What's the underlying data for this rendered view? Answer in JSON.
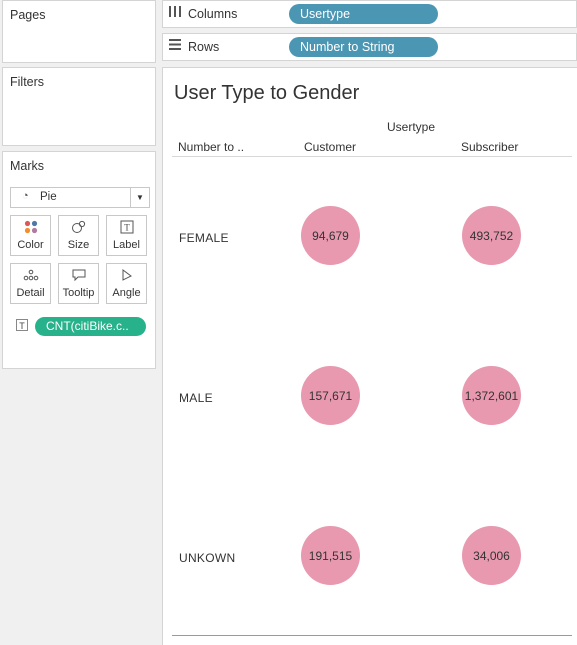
{
  "panes": {
    "pages": "Pages",
    "filters": "Filters",
    "marks": "Marks"
  },
  "marks": {
    "type": "Pie",
    "cards": [
      {
        "label": "Color",
        "icon": "color-icon"
      },
      {
        "label": "Size",
        "icon": "size-icon"
      },
      {
        "label": "Label",
        "icon": "label-icon"
      },
      {
        "label": "Detail",
        "icon": "detail-icon"
      },
      {
        "label": "Tooltip",
        "icon": "tooltip-icon"
      },
      {
        "label": "Angle",
        "icon": "angle-icon"
      }
    ],
    "label_field": "CNT(citiBike.c.."
  },
  "shelves": {
    "columns": {
      "label": "Columns",
      "pill": "Usertype"
    },
    "rows": {
      "label": "Rows",
      "pill": "Number to String"
    }
  },
  "view": {
    "title": "User Type to Gender",
    "column_group_header": "Usertype",
    "row_header": "Number to ..",
    "columns": [
      "Customer",
      "Subscriber"
    ],
    "rows": [
      {
        "label": "FEMALE",
        "values": [
          "94,679",
          "493,752"
        ]
      },
      {
        "label": "MALE",
        "values": [
          "157,671",
          "1,372,601"
        ]
      },
      {
        "label": "UNKOWN",
        "values": [
          "191,515",
          "34,006"
        ]
      }
    ],
    "mark_color": "#e899b0"
  }
}
